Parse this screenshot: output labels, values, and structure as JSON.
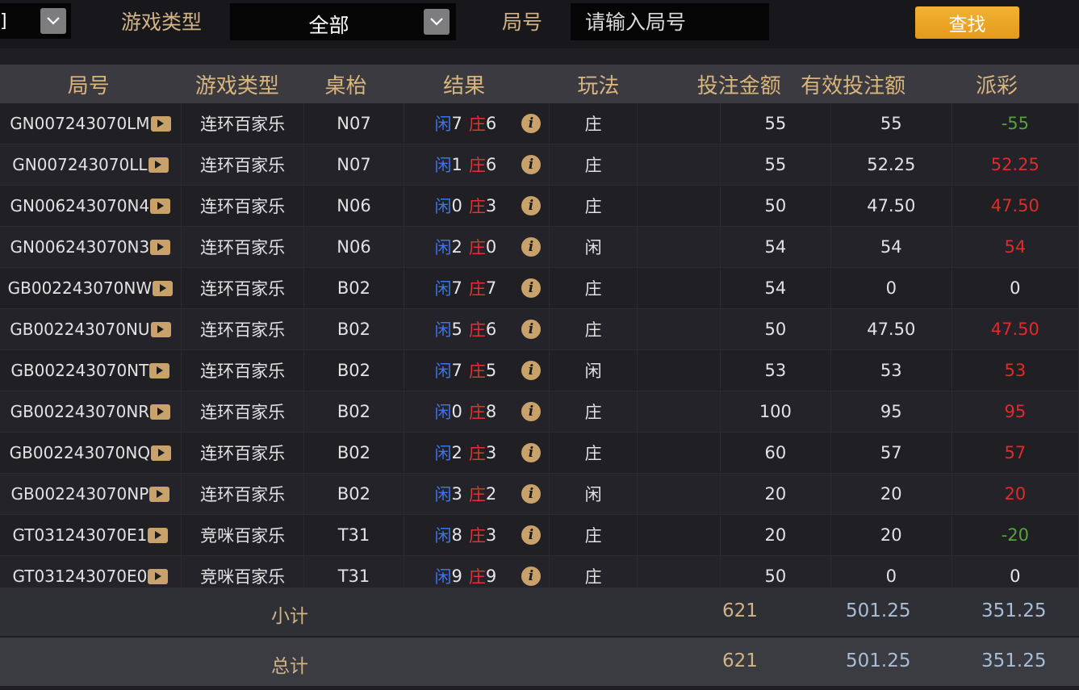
{
  "filters": {
    "left_select_fragment": "]",
    "game_type_label": "游戏类型",
    "game_type_value": "全部",
    "round_label": "局号",
    "round_placeholder": "请输入局号",
    "search_button": "查找"
  },
  "table": {
    "headers": [
      "局号",
      "游戏类型",
      "桌枱",
      "结果",
      "玩法",
      "投注金额",
      "有效投注额",
      "派彩"
    ],
    "result_labels": {
      "player": "闲",
      "banker": "庄"
    },
    "rows": [
      {
        "round": "GN007243070LM",
        "game": "连环百家乐",
        "table": "N07",
        "player": "7",
        "banker": "6",
        "play": "庄",
        "bet": "55",
        "valid": "55",
        "payout": "-55",
        "payout_sign": "neg"
      },
      {
        "round": "GN007243070LL",
        "game": "连环百家乐",
        "table": "N07",
        "player": "1",
        "banker": "6",
        "play": "庄",
        "bet": "55",
        "valid": "52.25",
        "payout": "52.25",
        "payout_sign": "pos"
      },
      {
        "round": "GN006243070N4",
        "game": "连环百家乐",
        "table": "N06",
        "player": "0",
        "banker": "3",
        "play": "庄",
        "bet": "50",
        "valid": "47.50",
        "payout": "47.50",
        "payout_sign": "pos"
      },
      {
        "round": "GN006243070N3",
        "game": "连环百家乐",
        "table": "N06",
        "player": "2",
        "banker": "0",
        "play": "闲",
        "bet": "54",
        "valid": "54",
        "payout": "54",
        "payout_sign": "pos"
      },
      {
        "round": "GB002243070NW",
        "game": "连环百家乐",
        "table": "B02",
        "player": "7",
        "banker": "7",
        "play": "庄",
        "bet": "54",
        "valid": "0",
        "payout": "0",
        "payout_sign": "zero"
      },
      {
        "round": "GB002243070NU",
        "game": "连环百家乐",
        "table": "B02",
        "player": "5",
        "banker": "6",
        "play": "庄",
        "bet": "50",
        "valid": "47.50",
        "payout": "47.50",
        "payout_sign": "pos"
      },
      {
        "round": "GB002243070NT",
        "game": "连环百家乐",
        "table": "B02",
        "player": "7",
        "banker": "5",
        "play": "闲",
        "bet": "53",
        "valid": "53",
        "payout": "53",
        "payout_sign": "pos"
      },
      {
        "round": "GB002243070NR",
        "game": "连环百家乐",
        "table": "B02",
        "player": "0",
        "banker": "8",
        "play": "庄",
        "bet": "100",
        "valid": "95",
        "payout": "95",
        "payout_sign": "pos"
      },
      {
        "round": "GB002243070NQ",
        "game": "连环百家乐",
        "table": "B02",
        "player": "2",
        "banker": "3",
        "play": "庄",
        "bet": "60",
        "valid": "57",
        "payout": "57",
        "payout_sign": "pos"
      },
      {
        "round": "GB002243070NP",
        "game": "连环百家乐",
        "table": "B02",
        "player": "3",
        "banker": "2",
        "play": "闲",
        "bet": "20",
        "valid": "20",
        "payout": "20",
        "payout_sign": "pos"
      },
      {
        "round": "GT031243070E1",
        "game": "竞咪百家乐",
        "table": "T31",
        "player": "8",
        "banker": "3",
        "play": "庄",
        "bet": "20",
        "valid": "20",
        "payout": "-20",
        "payout_sign": "neg"
      },
      {
        "round": "GT031243070E0",
        "game": "竞咪百家乐",
        "table": "T31",
        "player": "9",
        "banker": "9",
        "play": "庄",
        "bet": "50",
        "valid": "0",
        "payout": "0",
        "payout_sign": "zero"
      }
    ]
  },
  "subtotal": {
    "label": "小计",
    "bet": "621",
    "valid": "501.25",
    "payout": "351.25"
  },
  "total": {
    "label": "总计",
    "bet": "621",
    "valid": "501.25",
    "payout": "351.25"
  },
  "colors": {
    "accent": "#d2b384",
    "button": "#eea629",
    "player_blue": "#3f74e6",
    "banker_red": "#e03434",
    "win_red": "#e22a2a",
    "loss_green": "#54a33d"
  }
}
